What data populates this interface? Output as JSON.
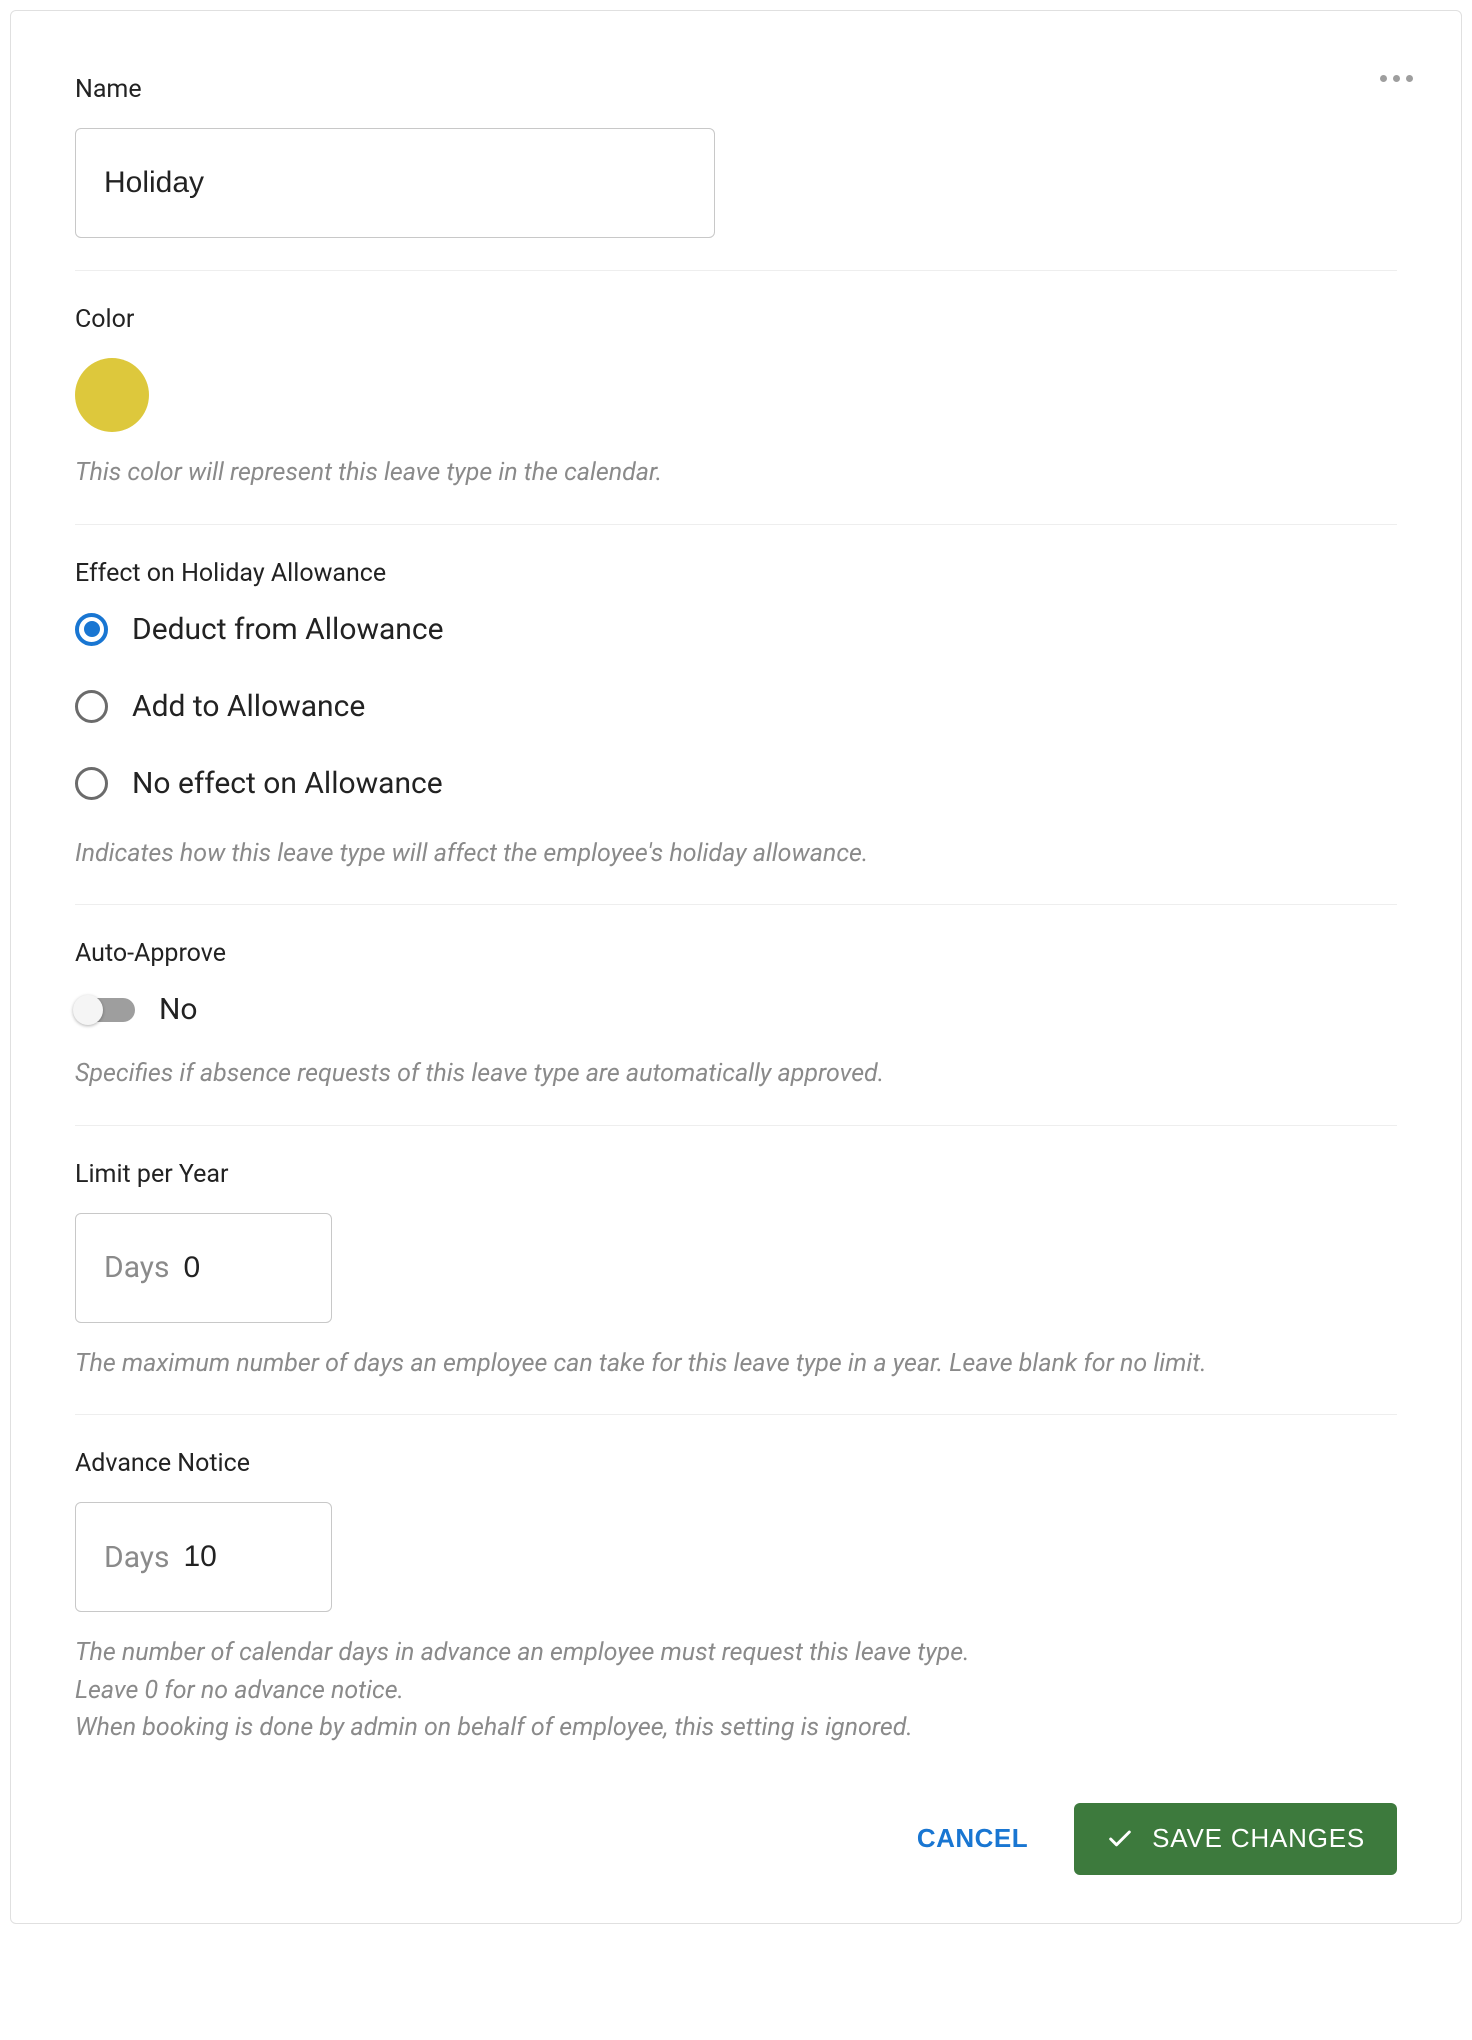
{
  "name": {
    "label": "Name",
    "value": "Holiday"
  },
  "color": {
    "label": "Color",
    "value": "#ddc83c",
    "hint": "This color will represent this leave type in the calendar."
  },
  "effect": {
    "label": "Effect on Holiday Allowance",
    "options": [
      {
        "label": "Deduct from Allowance",
        "selected": true
      },
      {
        "label": "Add to Allowance",
        "selected": false
      },
      {
        "label": "No effect on Allowance",
        "selected": false
      }
    ],
    "hint": "Indicates how this leave type will affect the employee's holiday allowance."
  },
  "autoApprove": {
    "label": "Auto-Approve",
    "value": false,
    "valueLabel": "No",
    "hint": "Specifies if absence requests of this leave type are automatically approved."
  },
  "limitPerYear": {
    "label": "Limit per Year",
    "prefix": "Days",
    "value": "0",
    "hint": "The maximum number of days an employee can take for this leave type in a year. Leave blank for no limit."
  },
  "advanceNotice": {
    "label": "Advance Notice",
    "prefix": "Days",
    "value": "10",
    "hint1": "The number of calendar days in advance an employee must request this leave type.",
    "hint2": "Leave 0 for no advance notice.",
    "hint3": "When booking is done by admin on behalf of employee, this setting is ignored."
  },
  "actions": {
    "cancel": "CANCEL",
    "save": "SAVE CHANGES"
  }
}
